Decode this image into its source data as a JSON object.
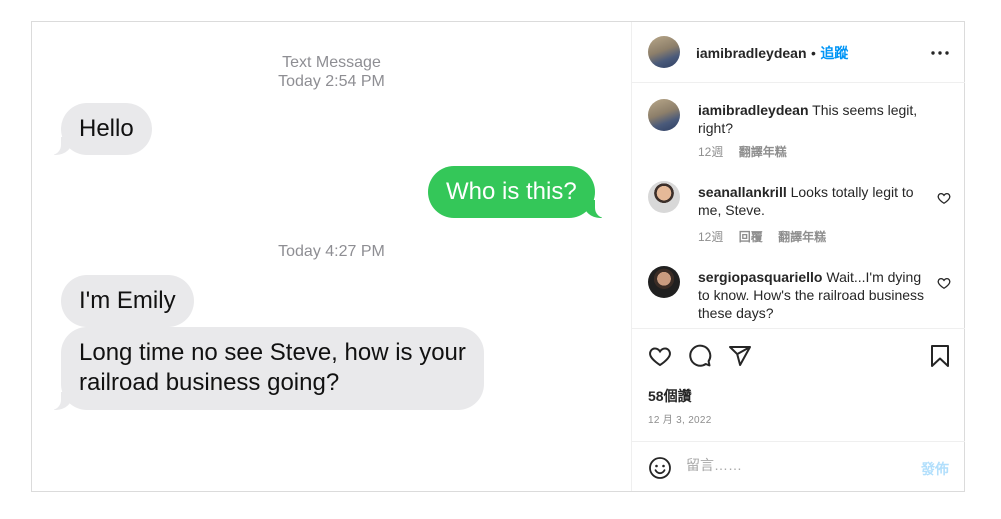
{
  "sms": {
    "header1_title": "Text Message",
    "header1_time": "Today 2:54 PM",
    "msg_hello": "Hello",
    "msg_who": "Who is this?",
    "header2_time": "Today 4:27 PM",
    "msg_emily": "I'm Emily",
    "msg_long_line1": "Long time no see Steve, how is your",
    "msg_long_line2": "railroad business going?",
    "colors": {
      "received_bubble": "#e9e9eb",
      "sent_bubble": "#34c759"
    }
  },
  "post": {
    "author": "iamibradleydean",
    "separator": "•",
    "follow_label": "追蹤",
    "more_icon": "more-horizontal-icon",
    "comments": [
      {
        "username": "iamibradleydean",
        "text": "This seems legit, right?",
        "age": "12週",
        "translate": "翻譯年糕",
        "reply": ""
      },
      {
        "username": "seanallankrill",
        "text": "Looks totally legit to me, Steve.",
        "age": "12週",
        "reply": "回覆",
        "translate": "翻譯年糕"
      },
      {
        "username": "sergiopasquariello",
        "text": "Wait...I'm dying to know. How's the railroad business these days?",
        "age": "",
        "reply": "",
        "translate": ""
      }
    ],
    "likes": "58個讚",
    "date": "12 月 3, 2022",
    "icons": {
      "like": "heart-icon",
      "comment": "comment-icon",
      "share": "share-icon",
      "save": "bookmark-icon",
      "emoji": "emoji-icon"
    },
    "comment_placeholder": "留言……",
    "post_button": "發佈",
    "colors": {
      "follow": "#0095f6",
      "post_disabled": "#b2dffc"
    }
  }
}
